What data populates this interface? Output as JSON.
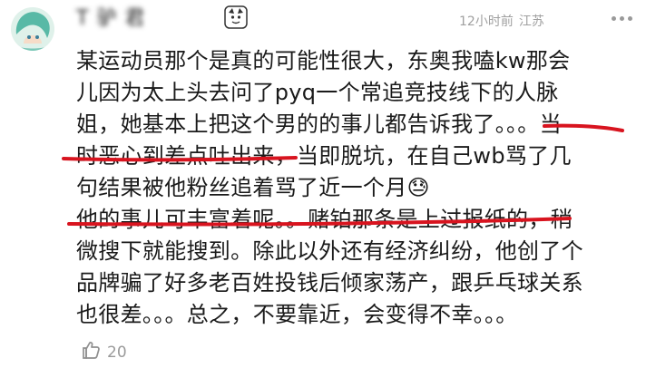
{
  "comment": {
    "username": "T    驴    君",
    "time": "12小时前",
    "location": "江苏",
    "lines": [
      "某运动员那个是真的可能性很大，东奥我嗑kw那会",
      "儿因为太上头去问了pyq一个常追竞技线下的人脉",
      "姐，她基本上把这个男的的事儿都告诉我了。。。当",
      "时恶心到差点吐出来，当即脱坑，在自己wb骂了几",
      "句结果被他粉丝追着骂了近一个月😓",
      "他的事儿可丰富着呢。。赌铂那条是上过报纸的，稍",
      "微搜下就能搜到。除此以外还有经济纠纷，他创了个",
      "品牌骗了好多老百姓投钱后倾家荡产，跟乒乓球关系",
      "也很差。。。总之，不要靠近，会变得不幸。。。"
    ],
    "like_count": "20"
  },
  "colors": {
    "annotation_red": "#d8141f",
    "meta_gray": "#a0a0a0"
  },
  "icons": {
    "avatar": "anime-avatar",
    "badge": "cartoon-badge-icon",
    "more": "more-dots-icon",
    "like": "thumbs-up-icon"
  }
}
